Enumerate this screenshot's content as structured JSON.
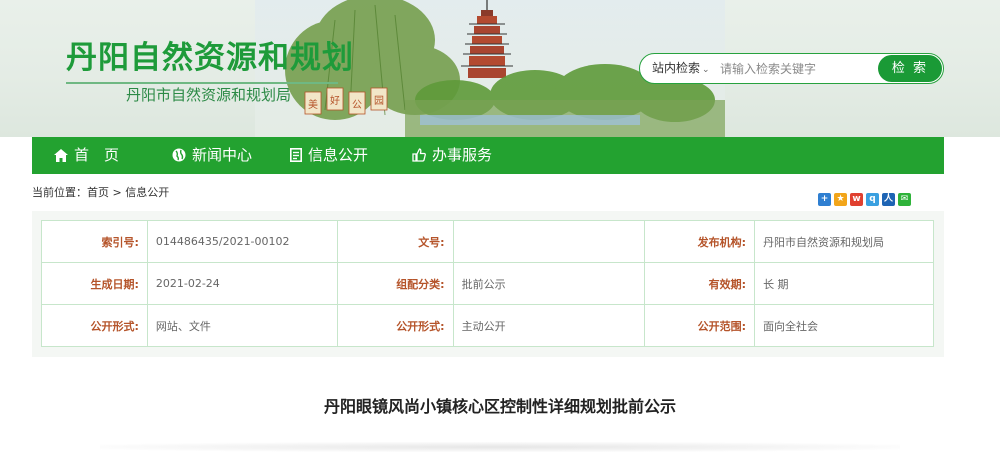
{
  "header": {
    "site_title": "丹阳自然资源和规划",
    "site_subtitle": "丹阳市自然资源和规划局",
    "banner_art_text": "美 好 公 园"
  },
  "search": {
    "scope": "站内检索",
    "placeholder": "请输入检索关键字",
    "button": "检 索"
  },
  "nav": [
    {
      "label": "首　页",
      "icon": "home-icon"
    },
    {
      "label": "新闻中心",
      "icon": "globe-icon"
    },
    {
      "label": "信息公开",
      "icon": "document-icon"
    },
    {
      "label": "办事服务",
      "icon": "thumbs-up-icon"
    }
  ],
  "breadcrumb": {
    "prefix": "当前位置：",
    "home": "首页",
    "sep": " > ",
    "current": "信息公开"
  },
  "share_icons": [
    "share-add-icon",
    "qzone-icon",
    "weibo-icon",
    "qq-icon",
    "renren-icon",
    "wechat-icon"
  ],
  "meta": {
    "rows": [
      [
        {
          "label": "索引号:",
          "value": "014486435/2021-00102"
        },
        {
          "label": "文号:",
          "value": ""
        },
        {
          "label": "发布机构:",
          "value": "丹阳市自然资源和规划局"
        }
      ],
      [
        {
          "label": "生成日期:",
          "value": "2021-02-24"
        },
        {
          "label": "组配分类:",
          "value": "批前公示"
        },
        {
          "label": "有效期:",
          "value": "长 期"
        }
      ],
      [
        {
          "label": "公开形式:",
          "value": "网站、文件"
        },
        {
          "label": "公开形式:",
          "value": "主动公开"
        },
        {
          "label": "公开范围:",
          "value": "面向全社会"
        }
      ]
    ]
  },
  "article": {
    "title": "丹阳眼镜风尚小镇核心区控制性详细规划批前公示"
  },
  "colors": {
    "brand_green": "#23a230",
    "title_green": "#1e9b3a",
    "label_orange": "#b5542a",
    "cell_border": "#c7e6cb"
  }
}
